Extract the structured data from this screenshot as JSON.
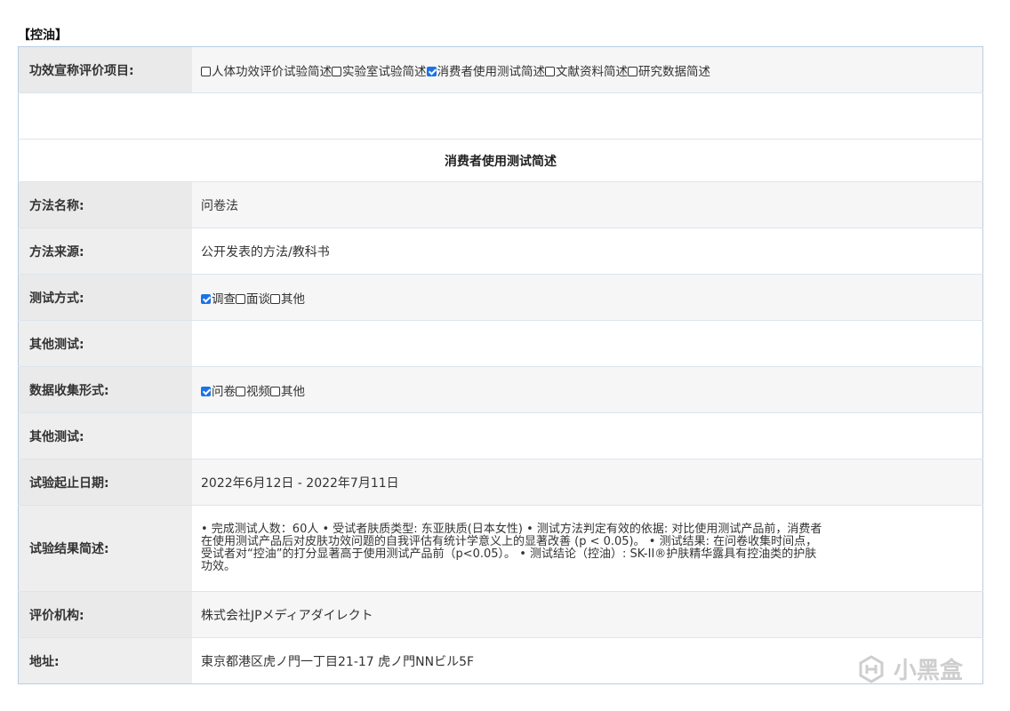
{
  "section_title": "【控油】",
  "claim_row": {
    "label": "功效宣称评价项目:",
    "options": [
      {
        "text": "人体功效评价试验简述",
        "checked": false
      },
      {
        "text": "实验室试验简述",
        "checked": false
      },
      {
        "text": "消费者使用测试简述",
        "checked": true
      },
      {
        "text": "文献资料简述",
        "checked": false
      },
      {
        "text": "研究数据简述",
        "checked": false
      }
    ]
  },
  "subsection_heading": "消费者使用测试简述",
  "method_name": {
    "label": "方法名称:",
    "value": "问卷法"
  },
  "method_source": {
    "label": "方法来源:",
    "value": "公开发表的方法/教科书"
  },
  "test_mode": {
    "label": "测试方式:",
    "options": [
      {
        "text": "调查",
        "checked": true
      },
      {
        "text": "面谈",
        "checked": false
      },
      {
        "text": "其他",
        "checked": false
      }
    ]
  },
  "other_test_1": {
    "label": "其他测试:",
    "value": ""
  },
  "data_collection": {
    "label": "数据收集形式:",
    "options": [
      {
        "text": "问卷",
        "checked": true
      },
      {
        "text": "视频",
        "checked": false
      },
      {
        "text": "其他",
        "checked": false
      }
    ]
  },
  "other_test_2": {
    "label": "其他测试:",
    "value": ""
  },
  "test_period": {
    "label": "试验起止日期:",
    "value": "2022年6月12日 - 2022年7月11日"
  },
  "result_summary": {
    "label": "试验结果简述:",
    "value": "• 完成测试人数：60人 • 受试者肤质类型: 东亚肤质(日本女性) • 测试方法判定有效的依据: 对比使用测试产品前，消费者在使用测试产品后对皮肤功效问题的自我评估有统计学意义上的显著改善 (p < 0.05)。 • 测试结果: 在问卷收集时间点，受试者对“控油”的打分显著高于使用测试产品前（p<0.05）。 • 测试结论（控油）: SK-II®护肤精华露具有控油类的护肤功效。"
  },
  "institution": {
    "label": "评价机构:",
    "value": "株式会社JPメディアダイレクト"
  },
  "address": {
    "label": "地址:",
    "value": "東京都港区虎ノ門一丁目21-17 虎ノ門NNビル5F"
  },
  "watermark_text": "小黑盒",
  "colors": {
    "checkbox_checked": "#1a73e8",
    "table_border": "#b9cde3",
    "label_bg": "#eeeeee"
  }
}
